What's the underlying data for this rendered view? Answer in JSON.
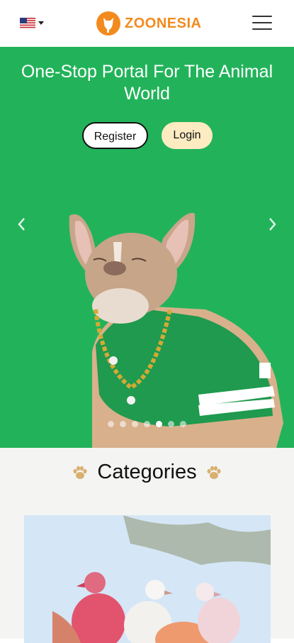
{
  "header": {
    "language_icon": "us-flag-icon",
    "logo_text": "ZOONESIA",
    "logo_icon": "orange-animal-silhouette-icon",
    "menu_icon": "hamburger-menu-icon"
  },
  "hero": {
    "title": "One-Stop Portal For The Animal World",
    "register_label": "Register",
    "login_label": "Login",
    "prev_icon": "chevron-left-icon",
    "next_icon": "chevron-right-icon",
    "slide_count": 7,
    "active_slide": 5,
    "background": "#22b35a"
  },
  "categories": {
    "title": "Categories",
    "decor_icon": "paw-icon"
  },
  "colors": {
    "brand": "#f28a1d",
    "login_bg": "#fdebc2"
  }
}
